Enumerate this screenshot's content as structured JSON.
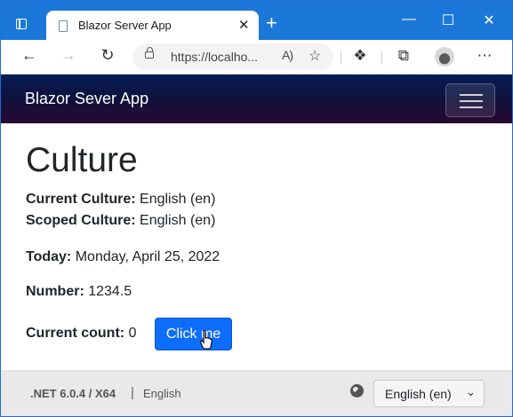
{
  "browser": {
    "tab_title": "Blazor Server App",
    "tab_close": "✕",
    "new_tab": "+",
    "url": "https://localho...",
    "read_aloud": "A)",
    "window_controls": {
      "minimize": "—",
      "maximize": "☐",
      "close": "✕"
    },
    "accent_color": "#1b78d8"
  },
  "navbar": {
    "brand": "Blazor Sever App"
  },
  "main": {
    "title": "Culture",
    "current_culture_label": "Current Culture:",
    "current_culture_value": "English (en)",
    "scoped_culture_label": "Scoped Culture:",
    "scoped_culture_value": "English (en)",
    "today_label": "Today:",
    "today_value": "Monday, April 25, 2022",
    "number_label": "Number:",
    "number_value": "1234.5",
    "count_label": "Current count:",
    "count_value": "0",
    "button_label": "Click me",
    "button_color": "#0d6efd"
  },
  "footer": {
    "version": ".NET 6.0.4 / X64",
    "separator": "|",
    "language": "English",
    "select_value": "English (en)"
  }
}
